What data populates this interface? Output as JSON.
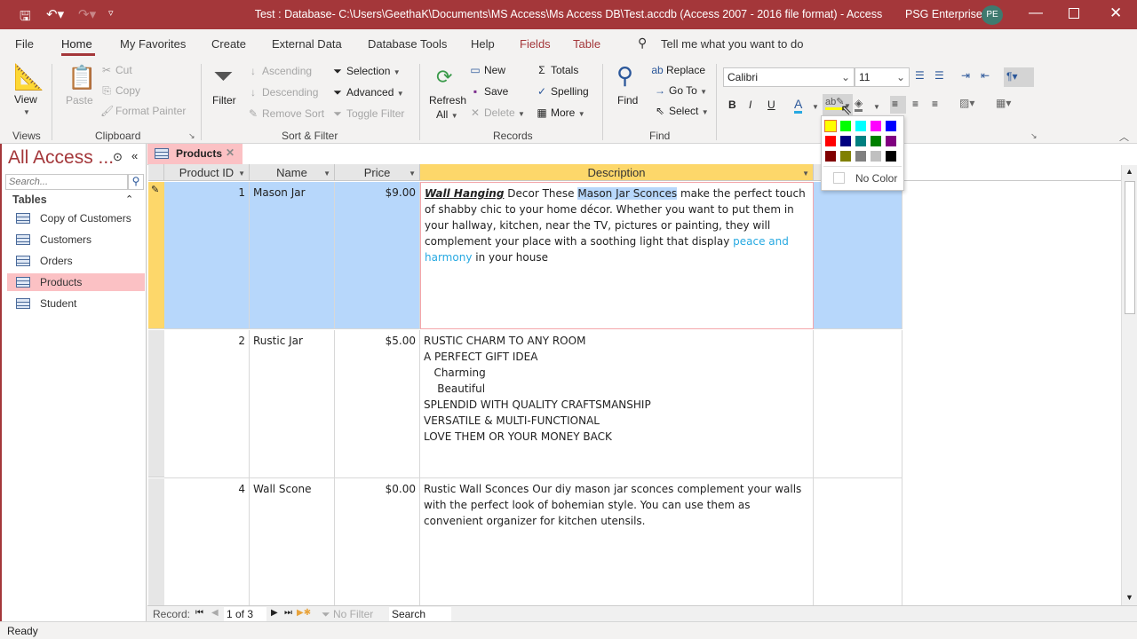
{
  "titlebar": {
    "title": "Test : Database- C:\\Users\\GeethaK\\Documents\\MS Access\\Ms Access DB\\Test.accdb (Access 2007 - 2016 file format)  -  Access",
    "user": "PSG Enterprises",
    "avatar": "PE",
    "accent": "#a4373a"
  },
  "menu": {
    "tabs": [
      "File",
      "Home",
      "My Favorites",
      "Create",
      "External Data",
      "Database Tools",
      "Help",
      "Fields",
      "Table"
    ],
    "active": "Home",
    "tell_me": "Tell me what you want to do"
  },
  "ribbon": {
    "views": {
      "view": "View",
      "group": "Views"
    },
    "clipboard": {
      "paste": "Paste",
      "cut": "Cut",
      "copy": "Copy",
      "format_painter": "Format Painter",
      "group": "Clipboard"
    },
    "sort_filter": {
      "filter": "Filter",
      "ascending": "Ascending",
      "descending": "Descending",
      "remove_sort": "Remove Sort",
      "selection": "Selection",
      "advanced": "Advanced",
      "toggle_filter": "Toggle Filter",
      "group": "Sort & Filter"
    },
    "records": {
      "refresh": "Refresh",
      "refresh_all": "All",
      "new": "New",
      "save": "Save",
      "delete": "Delete",
      "totals": "Totals",
      "spelling": "Spelling",
      "more": "More",
      "group": "Records"
    },
    "find": {
      "find": "Find",
      "replace": "Replace",
      "goto": "Go To",
      "select": "Select",
      "group": "Find"
    },
    "text": {
      "font": "Calibri",
      "size": "11",
      "bold": "B",
      "italic": "I",
      "underline": "U"
    }
  },
  "highlight_popup": {
    "colors": [
      "#ffff00",
      "#00ff00",
      "#00ffff",
      "#ff00ff",
      "#0000ff",
      "#ff0000",
      "#000080",
      "#008080",
      "#008000",
      "#800080",
      "#800000",
      "#808000",
      "#808080",
      "#c0c0c0",
      "#000000"
    ],
    "selected": "#ffff00",
    "no_color": "No Color"
  },
  "nav": {
    "title": "All Access ...",
    "search_placeholder": "Search...",
    "section": "Tables",
    "items": [
      "Copy of Customers",
      "Customers",
      "Orders",
      "Products",
      "Student"
    ],
    "selected": "Products"
  },
  "doc_tab": {
    "label": "Products"
  },
  "table": {
    "columns": [
      "Product ID",
      "Name",
      "Price",
      "Description"
    ],
    "rows": [
      {
        "id": "1",
        "name": "Mason Jar",
        "price": "$9.00",
        "desc_bold": "Wall Hanging",
        "desc_a": " Decor These ",
        "desc_hl": "Mason Jar Sconces",
        "desc_b": " make the perfect touch of shabby chic to your home décor. Whether you want to put them in your hallway, kitchen, near the TV, pictures or painting, they will complement your place with a soothing light that display ",
        "desc_colored": "peace and harmony",
        "desc_c": " in your house"
      },
      {
        "id": "2",
        "name": "Rustic Jar",
        "price": "$5.00",
        "lines": [
          "RUSTIC CHARM TO ANY ROOM",
          "A PERFECT GIFT IDEA",
          "   Charming",
          "    Beautiful",
          "SPLENDID WITH QUALITY CRAFTSMANSHIP",
          "VERSATILE & MULTI-FUNCTIONAL",
          "LOVE THEM OR YOUR MONEY BACK"
        ]
      },
      {
        "id": "4",
        "name": "Wall Scone",
        "price": "$0.00",
        "desc": "Rustic Wall Sconces Our diy mason jar sconces complement your walls with the perfect look of bohemian style. You can use them as convenient organizer for kitchen utensils."
      }
    ]
  },
  "record_nav": {
    "label": "Record:",
    "current": "1 of 3",
    "filter": "No Filter",
    "search": "Search"
  },
  "status": {
    "text": "Ready"
  }
}
